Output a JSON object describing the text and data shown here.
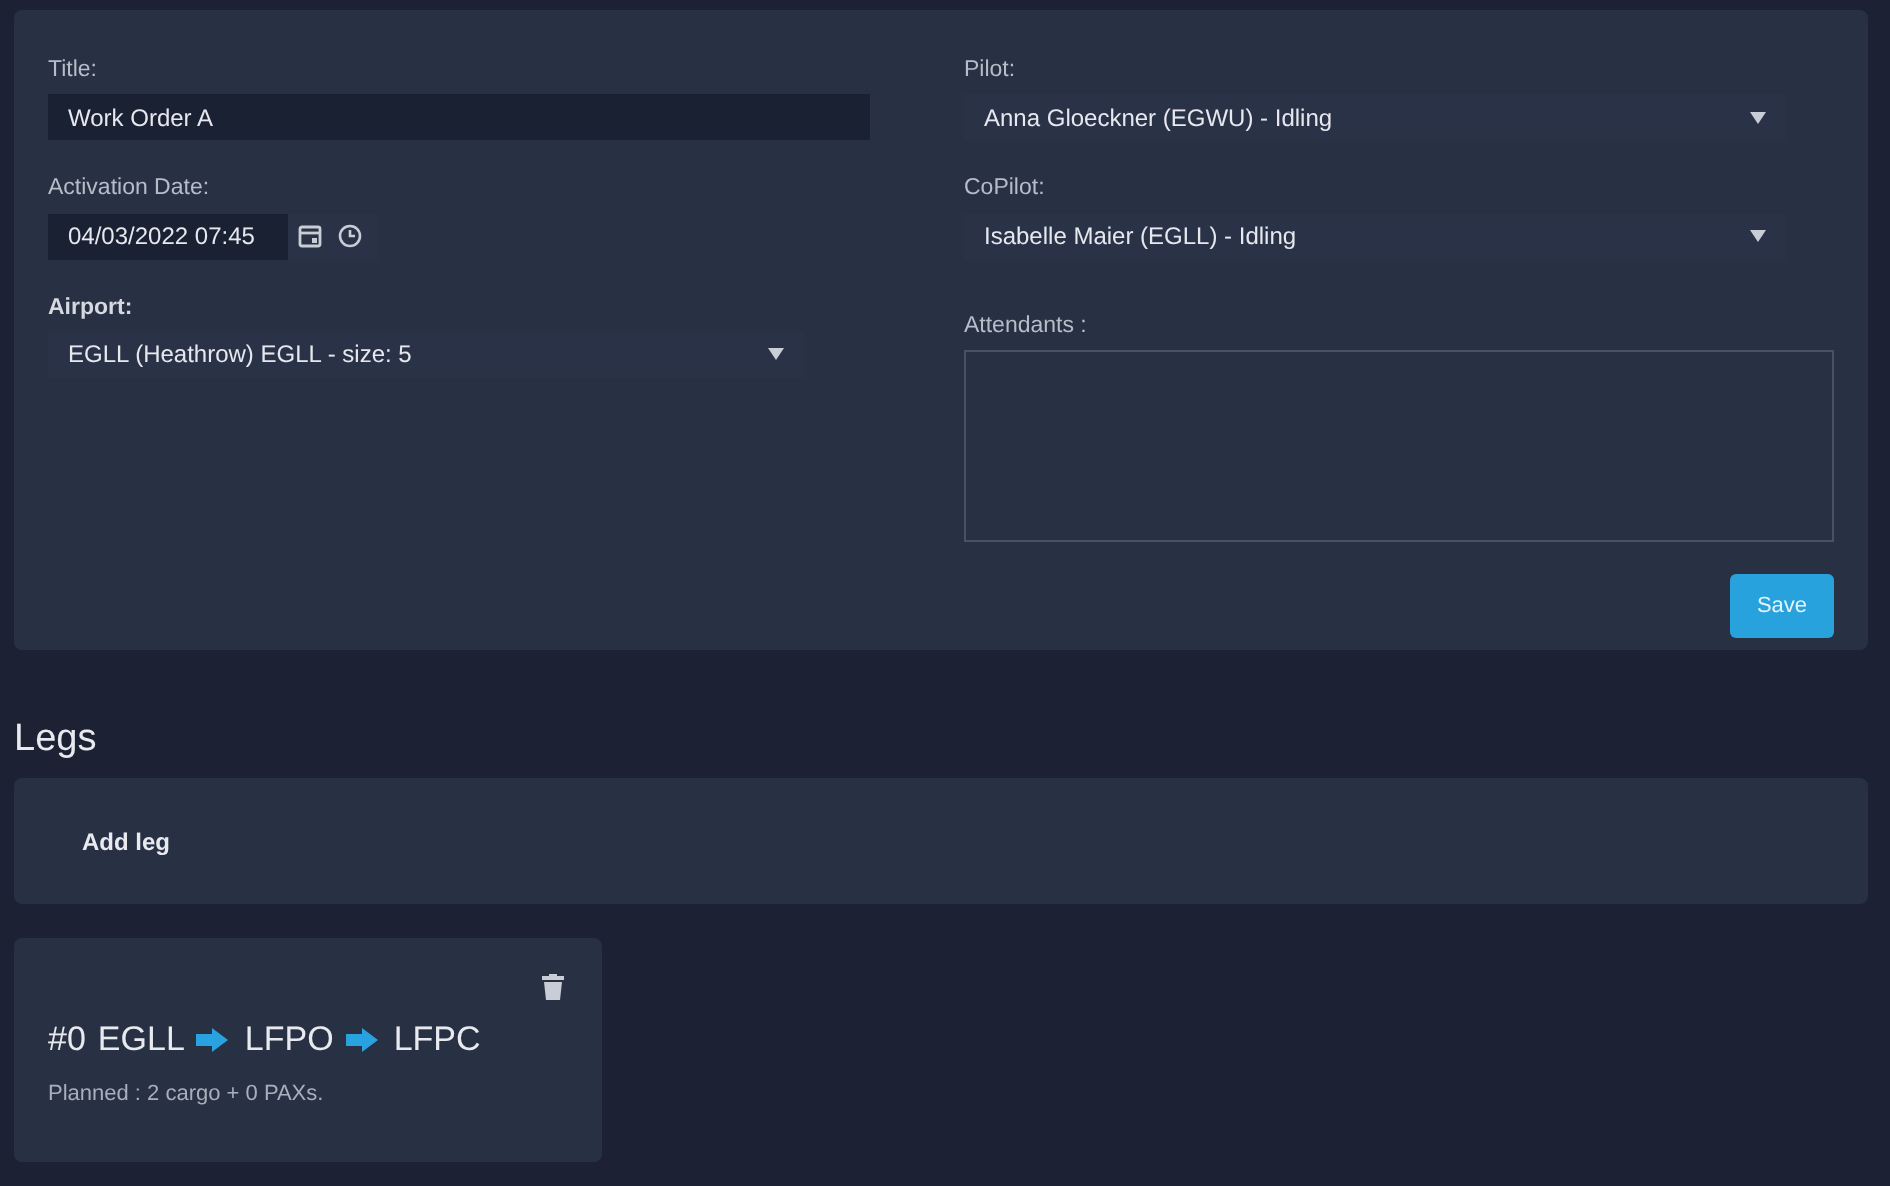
{
  "form": {
    "title": {
      "label": "Title:",
      "value": "Work Order A"
    },
    "activation_date": {
      "label": "Activation Date:",
      "value": "04/03/2022 07:45"
    },
    "airport": {
      "label": "Airport:",
      "value": "EGLL (Heathrow) EGLL - size: 5"
    },
    "pilot": {
      "label": "Pilot:",
      "value": "Anna Gloeckner (EGWU) - Idling"
    },
    "copilot": {
      "label": "CoPilot:",
      "value": "Isabelle Maier (EGLL) - Idling"
    },
    "attendants": {
      "label": "Attendants :"
    },
    "save_button": "Save"
  },
  "legs": {
    "heading": "Legs",
    "add_button": "Add leg",
    "items": [
      {
        "number": "#0",
        "stops": [
          "EGLL",
          "LFPO",
          "LFPC"
        ],
        "planned": "Planned : 2 cargo + 0 PAXs."
      }
    ]
  }
}
